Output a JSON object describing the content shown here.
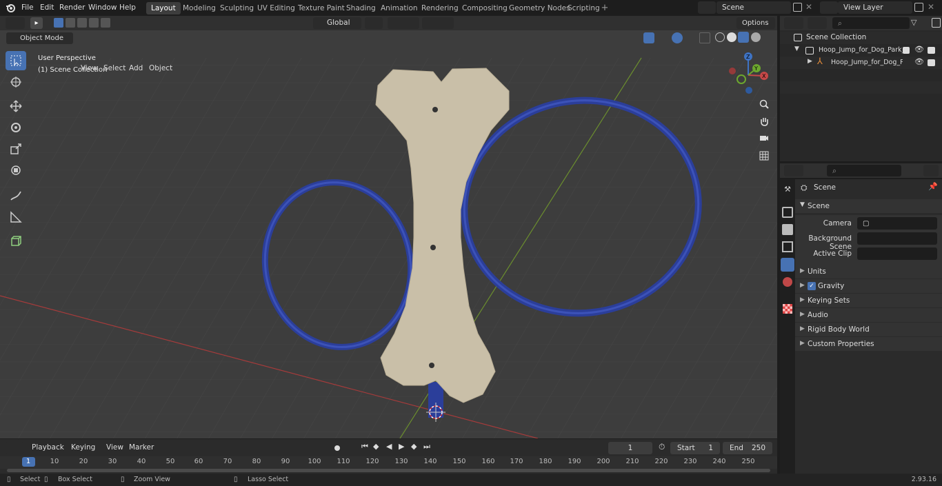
{
  "topbar": {
    "menus": [
      "File",
      "Edit",
      "Render",
      "Window",
      "Help"
    ],
    "workspaces": [
      "Layout",
      "Modeling",
      "Sculpting",
      "UV Editing",
      "Texture Paint",
      "Shading",
      "Animation",
      "Rendering",
      "Compositing",
      "Geometry Nodes",
      "Scripting"
    ],
    "active_workspace": "Layout",
    "scene_name": "Scene",
    "view_layer": "View Layer"
  },
  "tool_header": {
    "transform_orientation": "Global",
    "options_label": "Options"
  },
  "viewport_header": {
    "mode": "Object Mode",
    "menus": [
      "View",
      "Select",
      "Add",
      "Object"
    ]
  },
  "viewport": {
    "perspective_label": "User Perspective",
    "collection_label": "(1) Scene Collection",
    "gizmo_axes": {
      "x": "X",
      "y": "Y",
      "z": "Z"
    },
    "colors": {
      "hoop": "#2f3f9c",
      "bone": "#c9bfa8",
      "floor": "#3d3d3d",
      "x_axis": "#c84848",
      "y_axis": "#7aa83a"
    }
  },
  "timeline": {
    "menus": [
      "Playback",
      "Keying",
      "View",
      "Marker"
    ],
    "current_frame": "1",
    "start_label": "Start",
    "start_value": "1",
    "end_label": "End",
    "end_value": "250",
    "ticks": [
      "1",
      "10",
      "20",
      "30",
      "40",
      "50",
      "60",
      "70",
      "80",
      "90",
      "100",
      "110",
      "120",
      "130",
      "140",
      "150",
      "160",
      "170",
      "180",
      "190",
      "200",
      "210",
      "220",
      "230",
      "240",
      "250"
    ]
  },
  "statusbar": {
    "select": "Select",
    "box_select": "Box Select",
    "zoom_view": "Zoom View",
    "lasso_select": "Lasso Select",
    "version": "2.93.16"
  },
  "outliner": {
    "root": "Scene Collection",
    "items": [
      {
        "label": "Hoop_Jump_for_Dog_Park_Blu"
      },
      {
        "label": "Hoop_Jump_for_Dog_Parl"
      }
    ]
  },
  "properties": {
    "context": "Scene",
    "panel": "Scene",
    "fields": [
      {
        "label": "Camera"
      },
      {
        "label": "Background Scene"
      },
      {
        "label": "Active Clip"
      }
    ],
    "sections": [
      "Units",
      "Gravity",
      "Keying Sets",
      "Audio",
      "Rigid Body World",
      "Custom Properties"
    ],
    "gravity_checked": true
  }
}
